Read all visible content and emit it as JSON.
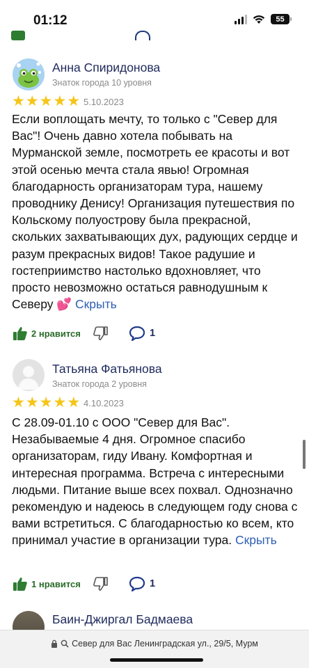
{
  "status_bar": {
    "time": "01:12",
    "battery": "55"
  },
  "reviews": [
    {
      "author": "Анна Спиридонова",
      "rank": "Знаток города 10 уровня",
      "rating": 5,
      "date": "5.10.2023",
      "text": "Если воплощать мечту, то только с \"Север для Вас\"! Очень давно хотела побывать на Мурманской земле, посмотреть ее красоты и вот этой осенью мечта стала явью! Огромная благодарность организаторам тура, нашему проводнику Денису! Организация путешествия по Кольскому полуострову была прекрасной, скольких захватывающих дух, радующих сердце и разум прекрасных видов! Такое радушие и гостеприимство настолько вдохновляет, что просто невозможно остаться равнодушным к Северу 💕 ",
      "hide_label": "Скрыть",
      "likes_label": "2 нравится",
      "comments": "1"
    },
    {
      "author": "Татьяна Фатьянова",
      "rank": "Знаток города 2 уровня",
      "rating": 5,
      "date": "4.10.2023",
      "text": "С 28.09-01.10 с ООО \"Север для Вас\". Незабываемые 4 дня. Огромное спасибо организаторам, гиду Ивану. Комфортная и интересная программа. Встреча с интересными людьми. Питание выше всех похвал. Однозначно рекомендую и надеюсь в следующем году снова с вами встретиться. С благодарностью ко всем, кто принимал участие в организации тура. ",
      "hide_label": "Скрыть",
      "likes_label": "1 нравится",
      "comments": "1"
    }
  ],
  "next_review": {
    "author": "Баин-Джиргал Бадмаева"
  },
  "browser": {
    "url": "Север для Вас Ленинградская ул., 29/5, Мурм"
  },
  "icons": {
    "like": "thumbs-up-icon",
    "dislike": "thumbs-down-icon",
    "comment": "comment-icon",
    "lock": "lock-icon",
    "search": "search-icon",
    "wifi": "wifi-icon",
    "signal": "signal-icon",
    "battery": "battery-icon"
  },
  "colors": {
    "star": "#f5c518",
    "link": "#2f5fb3",
    "author": "#1f2a5c",
    "like": "#2e7d32"
  }
}
